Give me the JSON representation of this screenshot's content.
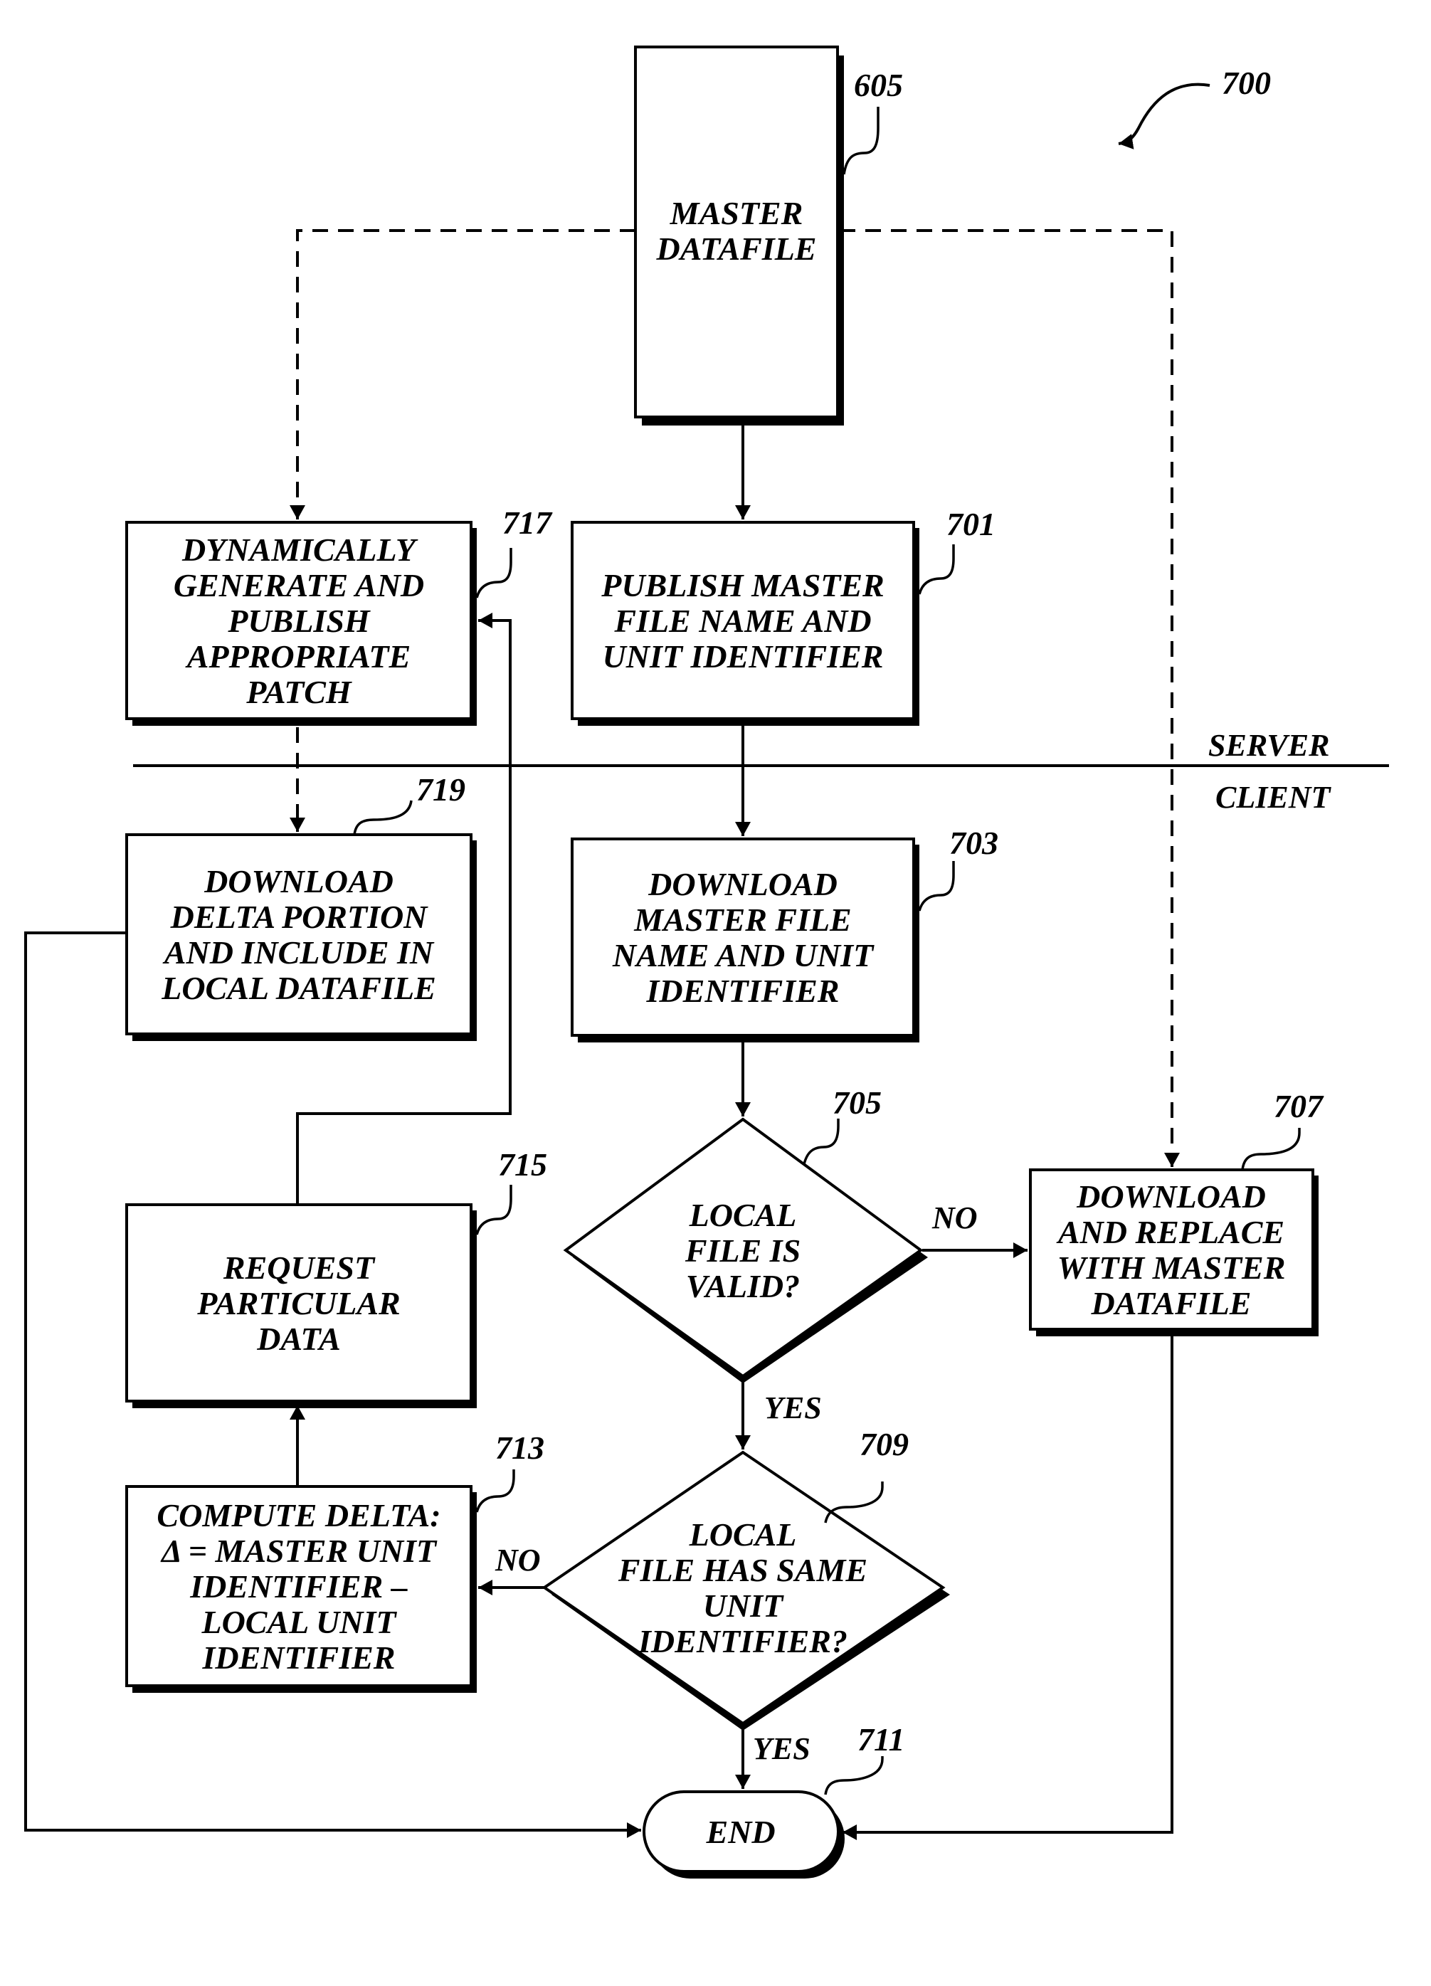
{
  "figure": {
    "figure_ref": "700",
    "zones": {
      "upper": "SERVER",
      "lower": "CLIENT"
    },
    "nodes": {
      "master": {
        "ref": "605",
        "lines": [
          "MASTER",
          "DATAFILE"
        ]
      },
      "n701": {
        "ref": "701",
        "lines": [
          "PUBLISH MASTER",
          "FILE NAME AND",
          "UNIT IDENTIFIER"
        ]
      },
      "n703": {
        "ref": "703",
        "lines": [
          "DOWNLOAD",
          "MASTER FILE",
          "NAME AND UNIT",
          "IDENTIFIER"
        ]
      },
      "n705": {
        "ref": "705",
        "lines": [
          "LOCAL",
          "FILE IS",
          "VALID?"
        ]
      },
      "n707": {
        "ref": "707",
        "lines": [
          "DOWNLOAD",
          "AND REPLACE",
          "WITH MASTER",
          "DATAFILE"
        ]
      },
      "n709": {
        "ref": "709",
        "lines": [
          "LOCAL",
          "FILE HAS SAME",
          "UNIT",
          "IDENTIFIER?"
        ]
      },
      "n711": {
        "ref": "711",
        "lines": [
          "END"
        ]
      },
      "n713": {
        "ref": "713",
        "lines": [
          "COMPUTE DELTA:",
          "Δ = MASTER UNIT",
          "IDENTIFIER –",
          "LOCAL UNIT",
          "IDENTIFIER"
        ]
      },
      "n715": {
        "ref": "715",
        "lines": [
          "REQUEST",
          "PARTICULAR",
          "DATA"
        ]
      },
      "n717": {
        "ref": "717",
        "lines": [
          "DYNAMICALLY",
          "GENERATE AND",
          "PUBLISH",
          "APPROPRIATE",
          "PATCH"
        ]
      },
      "n719": {
        "ref": "719",
        "lines": [
          "DOWNLOAD",
          "DELTA PORTION",
          "AND INCLUDE IN",
          "LOCAL DATAFILE"
        ]
      }
    },
    "edge_labels": {
      "e705_no": "NO",
      "e705_yes": "YES",
      "e709_no": "NO",
      "e709_yes": "YES"
    }
  }
}
